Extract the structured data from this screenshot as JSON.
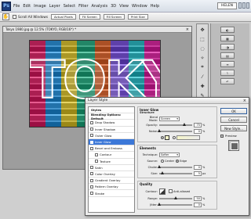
{
  "window": {
    "workspace_label": "HELEN",
    "menu": [
      "File",
      "Edit",
      "Image",
      "Layer",
      "Select",
      "Filter",
      "Analysis",
      "3D",
      "View",
      "Window",
      "Help"
    ]
  },
  "options_bar": {
    "scroll_all_label": "Scroll All Windows",
    "buttons": [
      "Actual Pixels",
      "Fit Screen",
      "Fill Screen",
      "Print Size"
    ]
  },
  "document": {
    "tab_title": "Tokyo 1980.jpg @ 12.5% (TOKYO, RGB/16*) *",
    "canvas_text": "TOKYO"
  },
  "dialog": {
    "title": "Layer Style",
    "styles_header": "Styles",
    "blending_label": "Blending Options: Default",
    "styles": [
      {
        "label": "Drop Shadow",
        "checked": false
      },
      {
        "label": "Inner Shadow",
        "checked": false
      },
      {
        "label": "Outer Glow",
        "checked": false
      },
      {
        "label": "Inner Glow",
        "checked": true,
        "selected": true
      },
      {
        "label": "Bevel and Emboss",
        "checked": false
      },
      {
        "label": "Contour",
        "checked": false
      },
      {
        "label": "Texture",
        "checked": false
      },
      {
        "label": "Satin",
        "checked": false
      },
      {
        "label": "Color Overlay",
        "checked": false
      },
      {
        "label": "Gradient Overlay",
        "checked": false
      },
      {
        "label": "Pattern Overlay",
        "checked": false
      },
      {
        "label": "Stroke",
        "checked": false
      }
    ],
    "panel_title": "Inner Glow",
    "structure": {
      "title": "Structure",
      "blend_mode_label": "Blend Mode:",
      "blend_mode": "Screen",
      "opacity_label": "Opacity:",
      "opacity": "75",
      "opacity_level": 0.75,
      "noise_label": "Noise:",
      "noise": "0",
      "noise_level": 0.0
    },
    "elements": {
      "title": "Elements",
      "technique_label": "Technique:",
      "technique": "Softer",
      "source_label": "Source:",
      "center_label": "Center",
      "edge_label": "Edge",
      "choke_label": "Choke:",
      "choke": "0",
      "choke_level": 0.0,
      "size_label": "Size:",
      "size": "5",
      "size_level": 0.1
    },
    "quality": {
      "title": "Quality",
      "contour_label": "Contour:",
      "anti_aliased_label": "Anti-aliased",
      "range_label": "Range:",
      "range": "50",
      "range_level": 0.5,
      "jitter_label": "Jitter:",
      "jitter": "0",
      "jitter_level": 0.0
    },
    "buttons": {
      "ok": "OK",
      "cancel": "Cancel",
      "new_style": "New Style...",
      "preview": "Preview"
    },
    "unit_percent": "%",
    "unit_px": "px"
  }
}
